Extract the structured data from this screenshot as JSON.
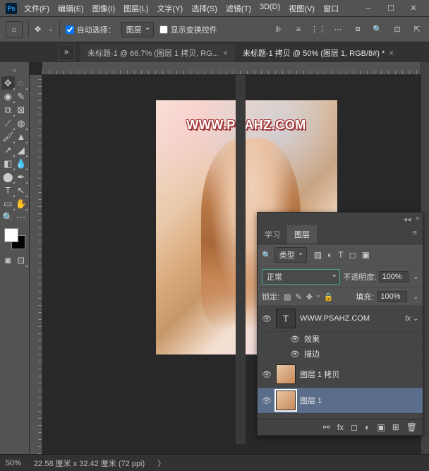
{
  "menu": [
    "文件(F)",
    "编辑(E)",
    "图像(I)",
    "图层(L)",
    "文字(Y)",
    "选择(S)",
    "滤镜(T)",
    "3D(D)",
    "视图(V)",
    "窗口"
  ],
  "opt": {
    "auto_select": "自动选择：",
    "target": "图层",
    "show_transform": "显示变换控件"
  },
  "tabs": [
    {
      "label": "未标题-1 @ 66.7% (图层 1 拷贝, RG...",
      "active": false
    },
    {
      "label": "未标题-1 拷贝 @ 50% (图层 1, RGB/8#) *",
      "active": true
    }
  ],
  "watermark": "WWW.PSAHZ.COM",
  "status": {
    "zoom": "50%",
    "dims": "22.58 厘米 x 32.42 厘米 (72 ppi)"
  },
  "panel": {
    "tabs": [
      "学习",
      "图层"
    ],
    "filter": "类型",
    "blend": "正常",
    "opacity_label": "不透明度:",
    "opacity": "100%",
    "lock_label": "锁定:",
    "fill_label": "填充:",
    "fill": "100%",
    "layers": [
      {
        "name": "WWW.PSAHZ.COM",
        "type": "text",
        "fx": true
      },
      {
        "sub": "效果"
      },
      {
        "sub": "描边"
      },
      {
        "name": "图层 1 拷贝",
        "type": "img"
      },
      {
        "name": "图层 1",
        "type": "img",
        "selected": true
      }
    ]
  }
}
